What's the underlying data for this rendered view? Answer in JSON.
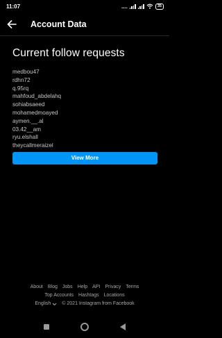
{
  "status_bar": {
    "time": "11:07",
    "dots": "....",
    "battery": "35"
  },
  "header": {
    "back_icon": "arrow-left-icon",
    "title": "Account Data"
  },
  "main": {
    "title": "Current follow requests",
    "requests": [
      "medbou47",
      "rdhn72",
      "q.95rq",
      "mahfoud_abdelahq",
      "sohiabsaeed",
      "mohamedmoayed",
      "aymen.__.al",
      "03.42__am",
      "ryu.elshall",
      "theycallmeraizel"
    ],
    "view_more_label": "View More",
    "accent_color": "#0095f6"
  },
  "footer": {
    "row1": [
      "About",
      "Blog",
      "Jobs",
      "Help",
      "API",
      "Privacy",
      "Terms"
    ],
    "row2": [
      "Top Accounts",
      "Hashtags",
      "Locations"
    ],
    "language": "English",
    "copyright": "© 2021 Instagram from Facebook"
  },
  "nav_bar": {
    "icons": [
      "recent-apps-icon",
      "home-icon",
      "back-icon"
    ]
  }
}
